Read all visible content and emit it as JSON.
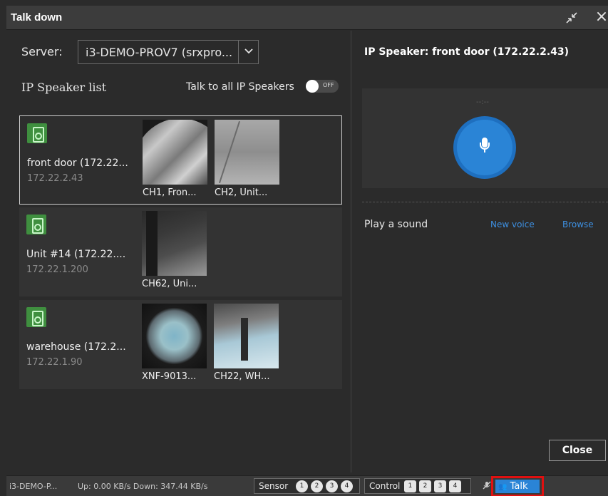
{
  "window": {
    "title": "Talk down",
    "close_icon": "×",
    "collapse_icon": "⤡"
  },
  "left": {
    "server_label": "Server:",
    "server_value": "i3-DEMO-PROV7 (srxpro...",
    "server_chevron": "v",
    "list_label": "IP Speaker list",
    "talk_all_label": "Talk to all IP Speakers",
    "toggle_state": "OFF",
    "speakers": [
      {
        "name": "front door (172.22...",
        "ip": "172.22.2.43",
        "cameras": [
          "CH1, Fron...",
          "CH2, Unit..."
        ]
      },
      {
        "name": "Unit #14 (172.22....",
        "ip": "172.22.1.200",
        "cameras": [
          "CH62, Uni..."
        ]
      },
      {
        "name": "warehouse (172.2...",
        "ip": "172.22.1.90",
        "cameras": [
          "XNF-9013...",
          "CH22, WH..."
        ]
      }
    ]
  },
  "right": {
    "title": "IP Speaker: front door (172.22.2.43)",
    "time_display": "--:--",
    "play_sound_label": "Play a sound",
    "new_voice_link": "New voice",
    "browse_link": "Browse",
    "close_button": "Close"
  },
  "status": {
    "server": "i3-DEMO-P...",
    "rates": "Up: 0.00 KB/s Down: 347.44 KB/s",
    "sensor_label": "Sensor",
    "sensor_items": [
      "1",
      "2",
      "3",
      "4"
    ],
    "control_label": "Control",
    "control_items": [
      "1",
      "2",
      "3",
      "4"
    ],
    "talk_button": "Talk",
    "talk_icon": "👥",
    "mute_icon": "🎙"
  }
}
